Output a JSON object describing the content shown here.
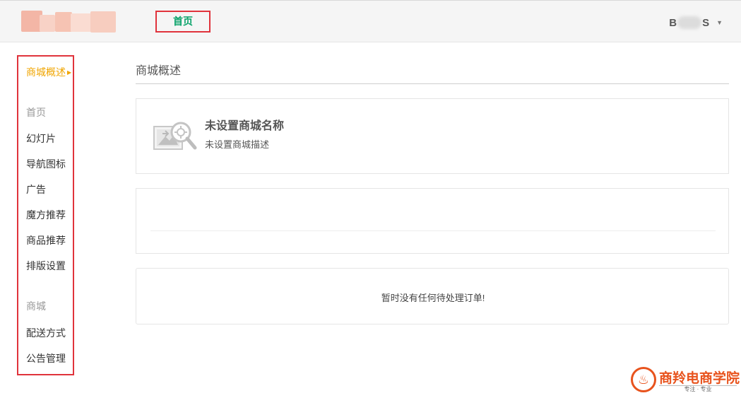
{
  "header": {
    "nav_home": "首页",
    "user": {
      "name_start": "B",
      "name_end": "S",
      "menu_icon": "caret-down-icon"
    }
  },
  "sidebar": {
    "overview": "商城概述",
    "groups": [
      {
        "label": "首页",
        "items": [
          "幻灯片",
          "导航图标",
          "广告",
          "魔方推荐",
          "商品推荐",
          "排版设置"
        ]
      },
      {
        "label": "商城",
        "items": [
          "配送方式",
          "公告管理"
        ]
      }
    ]
  },
  "main": {
    "page_title": "商城概述",
    "store": {
      "icon": "image-search-icon",
      "name": "未设置商城名称",
      "description": "未设置商城描述"
    },
    "orders": {
      "empty_message": "暂时没有任何待处理订单!"
    }
  },
  "watermark": {
    "text": "商羚电商学院",
    "subtext": "专注 · 专业"
  },
  "colors": {
    "accent_green": "#0aa36a",
    "active_orange": "#f0a500",
    "highlight_red": "#e0333c",
    "watermark_orange": "#e8531d"
  }
}
